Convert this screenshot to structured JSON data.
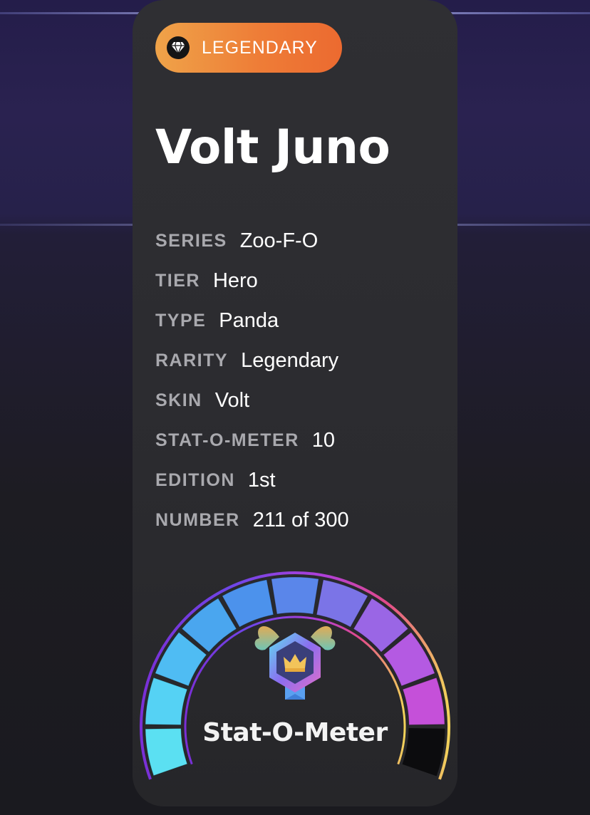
{
  "badge": {
    "label": "LEGENDARY",
    "icon": "diamond-icon",
    "color_start": "#efa349",
    "color_end": "#ec6a30"
  },
  "title": "Volt Juno",
  "attributes": [
    {
      "key": "SERIES",
      "value": "Zoo-F-O"
    },
    {
      "key": "TIER",
      "value": "Hero"
    },
    {
      "key": "TYPE",
      "value": "Panda"
    },
    {
      "key": "RARITY",
      "value": "Legendary"
    },
    {
      "key": "SKIN",
      "value": "Volt"
    },
    {
      "key": "STAT-O-METER",
      "value": "10"
    },
    {
      "key": "EDITION",
      "value": "1st"
    },
    {
      "key": "NUMBER",
      "value": "211 of 300"
    }
  ],
  "gauge": {
    "label": "Stat-O-Meter",
    "icon": "crown-medal-icon",
    "segments_total": 11,
    "segments_filled": 10,
    "colors": [
      "#5be0f2",
      "#55d2f4",
      "#4fbcf3",
      "#4aa6ef",
      "#4c92ec",
      "#5a86ea",
      "#7b74e7",
      "#9a66e5",
      "#b45ae2",
      "#c550d9",
      "#cf46c4"
    ]
  }
}
